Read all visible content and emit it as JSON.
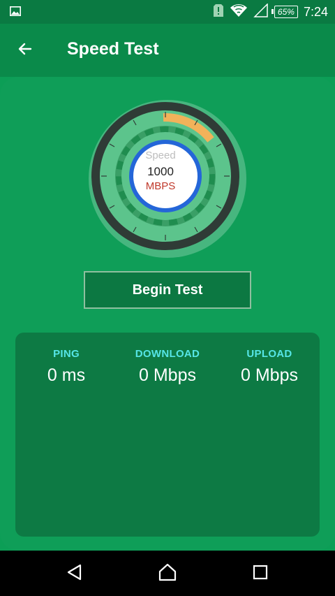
{
  "status_bar": {
    "battery": "65%",
    "time": "7:24",
    "icons": [
      "image-icon",
      "sim-alert-icon",
      "wifi-icon",
      "signal-icon",
      "battery-icon"
    ]
  },
  "app_bar": {
    "title": "Speed Test",
    "back_icon": "arrow-back-icon"
  },
  "gauge": {
    "label": "Speed",
    "value": "1000",
    "unit": "MBPS"
  },
  "actions": {
    "begin_label": "Begin Test"
  },
  "results": {
    "ping": {
      "label": "PING",
      "value": "0 ms"
    },
    "download": {
      "label": "DOWNLOAD",
      "value": "0 Mbps"
    },
    "upload": {
      "label": "UPLOAD",
      "value": "0 Mbps"
    }
  },
  "nav_bar": {
    "icons": [
      "nav-back-icon",
      "nav-home-icon",
      "nav-recents-icon"
    ]
  },
  "colors": {
    "background": "#0c9e56",
    "app_bar": "#0a8a4a",
    "results_panel": "#0d7a44",
    "metric_label": "#56e5e6",
    "gauge_accent": "#f2b25a",
    "gauge_ring": "#2f3b36"
  }
}
